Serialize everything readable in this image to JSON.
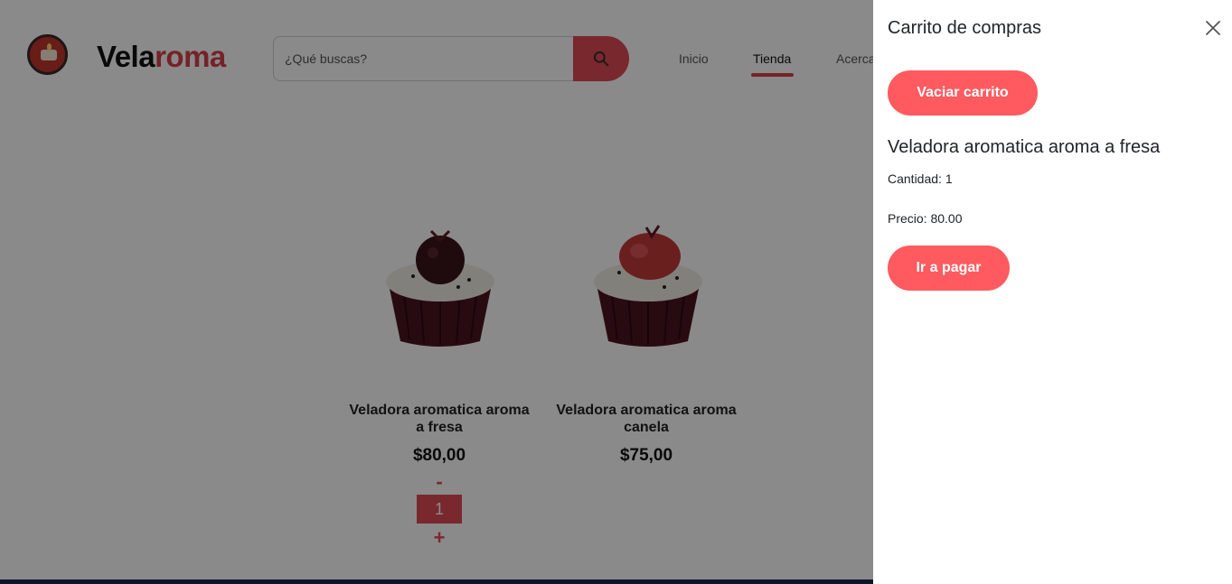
{
  "brand": {
    "part1": "Vela",
    "part2": "roma"
  },
  "search": {
    "placeholder": "¿Qué buscas?",
    "icon": "search-icon"
  },
  "nav": {
    "items": [
      {
        "label": "Inicio"
      },
      {
        "label": "Tienda"
      },
      {
        "label": "Acerca"
      }
    ],
    "active": "Tienda"
  },
  "products": [
    {
      "name": "Veladora aromatica aroma a fresa",
      "price": "$80,00",
      "quantity": "1",
      "minus": "-",
      "plus": "+",
      "topping": "chocolate"
    },
    {
      "name": "Veladora aromatica aroma canela",
      "price": "$75,00",
      "topping": "strawberry"
    }
  ],
  "cart": {
    "title": "Carrito de compras",
    "clear_label": "Vaciar carrito",
    "items": [
      {
        "name": "Veladora aromatica aroma a fresa",
        "quantity_text": "Cantidad: 1",
        "price_text": "Precio: 80.00"
      }
    ],
    "checkout_label": "Ir a pagar"
  },
  "colors": {
    "accent": "#e04a55",
    "drawer_button": "#ff5a5f",
    "brand_red": "#d9404d",
    "overlay": "rgba(0,0,0,0.46)"
  }
}
